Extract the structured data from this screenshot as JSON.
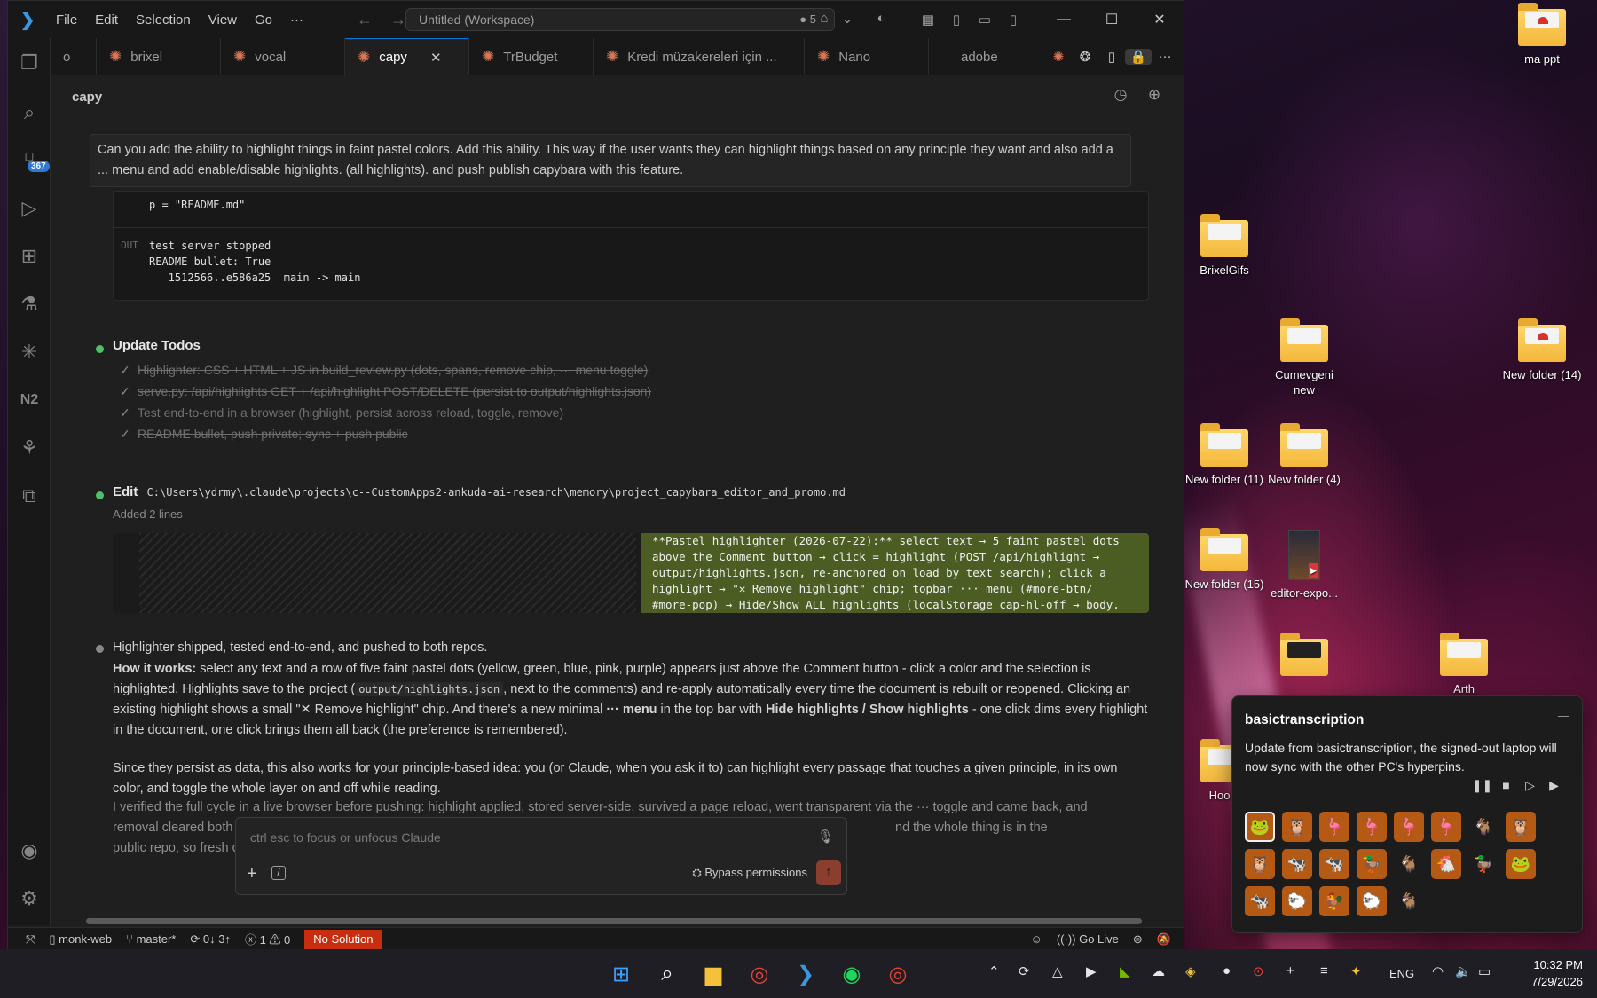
{
  "desktop": {
    "icons": [
      {
        "label": "ma ppt"
      },
      {
        "label": "BrixelGifs"
      },
      {
        "label": "Cumevgeni new"
      },
      {
        "label": "New folder (14)"
      },
      {
        "label": "New folder (11)"
      },
      {
        "label": "New folder (4)"
      },
      {
        "label": "New folder (15)"
      },
      {
        "label": "editor-expo..."
      },
      {
        "label": "Hoom"
      },
      {
        "label": "Arth"
      }
    ]
  },
  "titlebar": {
    "menus": [
      "File",
      "Edit",
      "Selection",
      "View",
      "Go",
      "···"
    ],
    "workspace": "Untitled (Workspace)",
    "count": "5"
  },
  "activity": {
    "source_control_badge": "367"
  },
  "tabs": [
    {
      "label": "o",
      "star": false
    },
    {
      "label": "brixel",
      "star": true
    },
    {
      "label": "vocal",
      "star": true
    },
    {
      "label": "capy",
      "star": true,
      "active": true
    },
    {
      "label": "TrBudget",
      "star": true
    },
    {
      "label": "Kredi müzakereleri için ...",
      "star": true
    },
    {
      "label": "Nano",
      "star": true
    },
    {
      "label": "adobe",
      "star": false
    }
  ],
  "panel": {
    "title": "capy"
  },
  "chat": {
    "user_message": "Can you add the ability to highlight things in faint pastel colors. Add this ability. This way if the user wants they can highlight things based on any principle they want and also add a ... menu and add enable/disable highlights. (all highlights). and push publish capybara with this feature.",
    "code_in": "p = \"README.md\"",
    "out_label": "OUT",
    "out_lines": [
      "test server stopped",
      "README bullet: True",
      "   1512566..e586a25  main -> main"
    ],
    "update_todos_label": "Update Todos",
    "todos": [
      "Highlighter: CSS + HTML + JS in build_review.py (dots, spans, remove chip, ··· menu toggle)",
      "serve.py: /api/highlights GET + /api/highlight POST/DELETE (persist to output/highlights.json)",
      "Test end-to-end in a browser (highlight, persist across reload, toggle, remove)",
      "README bullet, push private; sync + push public"
    ],
    "edit_label": "Edit",
    "edit_path": "C:\\Users\\ydrmy\\.claude\\projects\\c--CustomApps2-ankuda-ai-research\\memory\\project_capybara_editor_and_promo.md",
    "edit_summary": "Added 2 lines",
    "diff_lines": [
      "**Pastel highlighter (2026-07-22):** select text → 5 faint pastel dots",
      "above the Comment button → click = highlight (POST /api/highlight →",
      "output/highlights.json, re-anchored on load by text search); click a",
      "highlight → \"✕ Remove highlight\" chip; topbar ··· menu (#more-btn/",
      "#more-pop) → Hide/Show ALL highlights (localStorage cap-hl-off → body."
    ],
    "summary_heading": "Highlighter shipped, tested end-to-end, and pushed to both repos.",
    "how_label": "How it works:",
    "how_text_1": " select any text and a row of five faint pastel dots (yellow, green, blue, pink, purple) appears just above the Comment button - click a color and the selection is highlighted. Highlights save to the project (",
    "how_code": "output/highlights.json",
    "how_text_2": ", next to the comments) and re-apply automatically every time the document is rebuilt or reopened. Clicking an existing highlight shows a small \"✕ Remove highlight\" chip. And there's a new minimal ",
    "how_menu": "··· menu",
    "how_text_3": " in the top bar with ",
    "how_toggle": "Hide highlights / Show highlights",
    "how_text_4": " - one click dims every highlight in the document, one click brings them all back (the preference is remembered).",
    "principle_para": "Since they persist as data, this also works for your principle-based idea: you (or Claude, when you ask it to) can highlight every passage that touches a given principle, in its own color, and toggle the whole layer on and off while reading.",
    "verify_para_1": "I verified the full cycle in a live browser before pushing: highlight applied, stored server-side, survived a page reload, went transparent via the ··· toggle and came back, and",
    "verify_para_2a": "removal cleared both the p",
    "verify_para_2b": "nd the whole thing is in the",
    "verify_para_3": "public repo, so fresh clone"
  },
  "input": {
    "placeholder": "ctrl esc to focus or unfocus Claude",
    "bypass_label": "Bypass permissions"
  },
  "statusbar": {
    "remote": "monk-web",
    "branch": "master*",
    "sync": "0↓ 3↑",
    "errors": "1",
    "warnings": "0",
    "error_badge": "No Solution",
    "golive": "Go Live"
  },
  "notification": {
    "title": "basictranscription",
    "body": "Update from basictranscription, the signed-out laptop will now sync with the other PC's hyperpins.",
    "emojis": [
      "🐸",
      "🦉",
      "🦩",
      "🦩",
      "🦩",
      "🦩",
      "🐐",
      "🦉",
      "🦉",
      "🐄",
      "🐄",
      "🦆",
      "🐐",
      "🐔",
      "🦆",
      "🐸",
      "🐄",
      "🐑",
      "🐓",
      "🐑",
      "🐐"
    ]
  },
  "taskbar": {
    "language": "ENG",
    "time": "10:32 PM",
    "date": "7/29/2026"
  }
}
